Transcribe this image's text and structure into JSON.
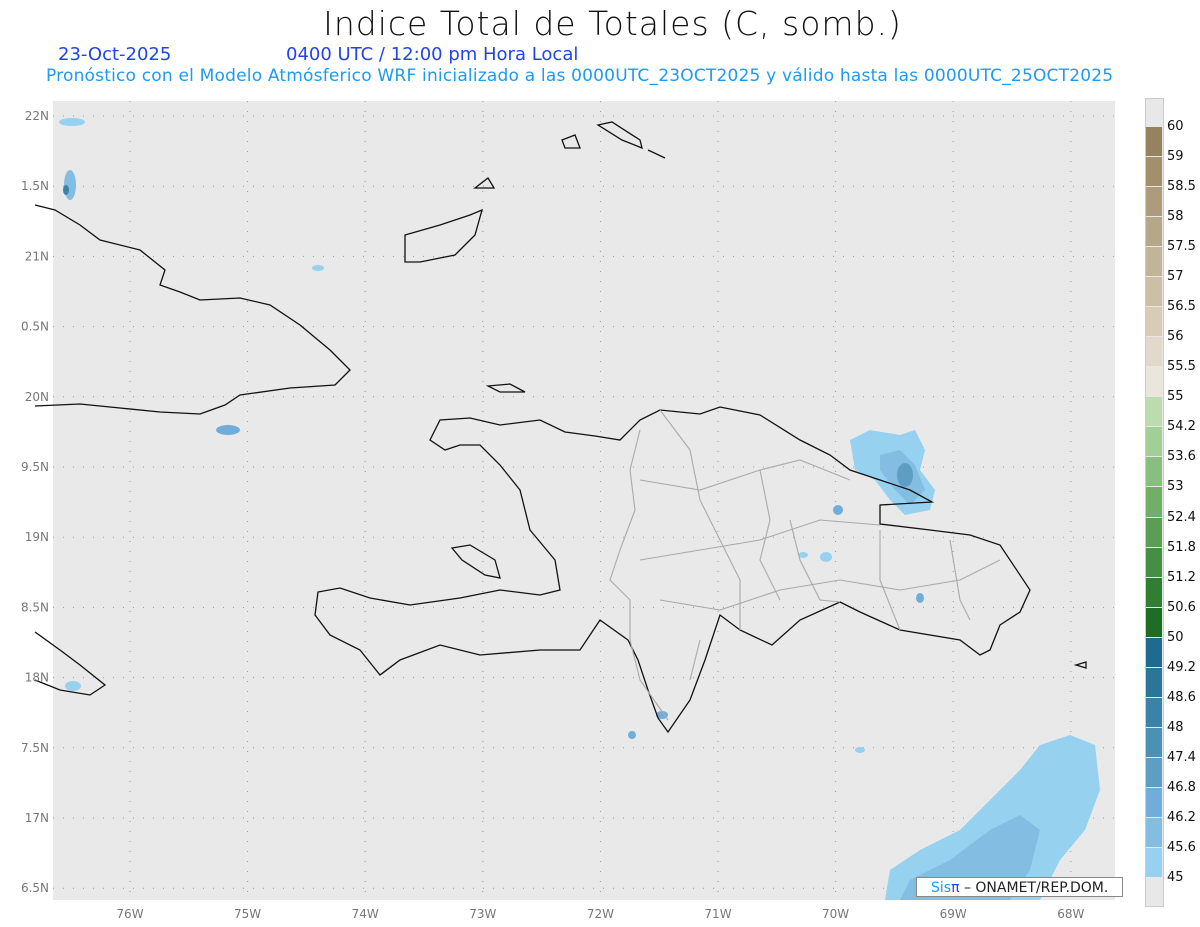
{
  "header": {
    "title": "Indice Total de Totales (C, somb.)",
    "date": "23-Oct-2025",
    "time": "0400 UTC / 12:00 pm Hora Local",
    "subtitle": "Pronóstico con el Modelo Atmósferico WRF inicializado a las 0000UTC_23OCT2025 y válido hasta las  0000UTC_25OCT2025"
  },
  "axes": {
    "lon_labels": [
      "76W",
      "75W",
      "74W",
      "73W",
      "72W",
      "71W",
      "70W",
      "69W",
      "68W"
    ],
    "lat_labels": [
      "22N",
      "1.5N",
      "21N",
      "0.5N",
      "20N",
      "9.5N",
      "19N",
      "8.5N",
      "18N",
      "7.5N",
      "17N",
      "6.5N"
    ]
  },
  "colorbar": {
    "labels": [
      "60",
      "59",
      "58.5",
      "58",
      "57.5",
      "57",
      "56.5",
      "56",
      "55.5",
      "55",
      "54.2",
      "53.6",
      "53",
      "52.4",
      "51.8",
      "51.2",
      "50.6",
      "50",
      "49.2",
      "48.6",
      "48",
      "47.4",
      "46.8",
      "46.2",
      "45.6",
      "45"
    ],
    "colors": [
      "#97825f",
      "#a48f6c",
      "#ad9b7b",
      "#b7a789",
      "#c2b498",
      "#ccbfa7",
      "#d6ccb8",
      "#e1d9ca",
      "#eae6dc",
      "#bcdcb0",
      "#a2cf96",
      "#89bf7e",
      "#71ae68",
      "#5a9e56",
      "#458f45",
      "#2f7f33",
      "#1d6e22",
      "#1f6a8f",
      "#2c7599",
      "#3b82a8",
      "#4c90b5",
      "#5e9ec4",
      "#71addb",
      "#84bde2",
      "#97d1f0"
    ]
  },
  "logo": {
    "sis": "Sis",
    "pi": "π",
    "rest": " – ONAMET/REP.DOM."
  }
}
